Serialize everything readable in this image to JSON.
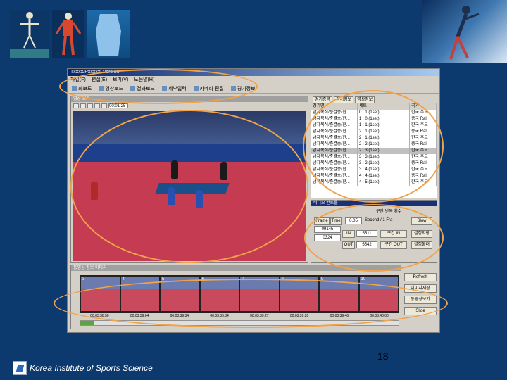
{
  "app": {
    "title": "Txxxx/Pxxxxxl Version",
    "menu": [
      "파일(F)",
      "편집(E)",
      "보기(V)",
      "도움말(H)"
    ],
    "toolbar": [
      "화보도",
      "영상보드",
      "결과보드",
      "세부입력",
      "카메라 편집",
      "경기정보"
    ]
  },
  "video_pane": {
    "caption": "영상 보기",
    "position_text": "00:01:25"
  },
  "list_pane": {
    "tabs": [
      "경기종목",
      "경기정보",
      "영상정보"
    ],
    "columns": [
      "경기명",
      "세트",
      "국가"
    ],
    "rows": [
      [
        "남자복식/준결승(한...",
        "0 : 1 (1set)",
        "한국 주요"
      ],
      [
        "남자복식/준결승(한...",
        "1 : 0 (1set)",
        "중국 Rall"
      ],
      [
        "남자복식/준결승(한...",
        "1 : 1 (1set)",
        "한국 주요"
      ],
      [
        "남자복식/준결승(한...",
        "2 : 1 (1set)",
        "중국 Rall"
      ],
      [
        "남자복식/준결승(한...",
        "2 : 1 (1set)",
        "한국 주요"
      ],
      [
        "남자복식/준결승(한...",
        "2 : 2 (1set)",
        "중국 Rall"
      ],
      [
        "남자복식/준결승(한...",
        "2 : 3 (1set)",
        "한국 주요"
      ],
      [
        "남자복식/준결승(한...",
        "3 : 3 (1set)",
        "한국 주요"
      ],
      [
        "남자복식/준결승(한...",
        "3 : 2 (1set)",
        "중국 Rall"
      ],
      [
        "남자복식/준결승(한...",
        "3 : 4 (1set)",
        "한국 주요"
      ],
      [
        "남자복식/준결승(한...",
        "4 : 4 (1set)",
        "중국 Rall"
      ],
      [
        "남자복식/준결승(한...",
        "4 : 5 (1set)",
        "한국 주요"
      ]
    ],
    "selected_row": 6
  },
  "control_pane": {
    "caption": "비디오 컨트롤",
    "rate_label": "구간 반복 횟수",
    "frame_btn": "Frame",
    "time_btn": "Time",
    "frame_value": "09145",
    "frame_value2": "0324",
    "in_btn": "IN",
    "out_btn": "OUT",
    "rate_value": "0.05",
    "unit": "Second / 1 Fra",
    "in_value": "5511",
    "out_value": "5542",
    "in_flag": "구간 IN",
    "out_flag": "구간 OUT",
    "slow_btn": "Slow",
    "save_btn": "설정저장",
    "load_btn": "설정불러"
  },
  "film_pane": {
    "caption": "동영상 정보 이미지",
    "frame_labels": [
      "3",
      "4",
      "5",
      "6",
      "7",
      "8",
      "9",
      "10"
    ],
    "timecodes": [
      "00:03:38:50",
      "00:03:39:04",
      "00:03:39:34",
      "00:03:39:34",
      "00:03:39:27",
      "00:03:39:20",
      "00:03:39:46",
      "00:03:40:00"
    ]
  },
  "side_buttons": [
    "Refresh",
    "이미지저장",
    "동영상보기",
    "Slide"
  ],
  "slide": {
    "page_number": "18",
    "footer": "Korea Institute of Sports Science"
  },
  "colors": {
    "background": "#0d3a6e",
    "highlight": "#f0a34a"
  }
}
